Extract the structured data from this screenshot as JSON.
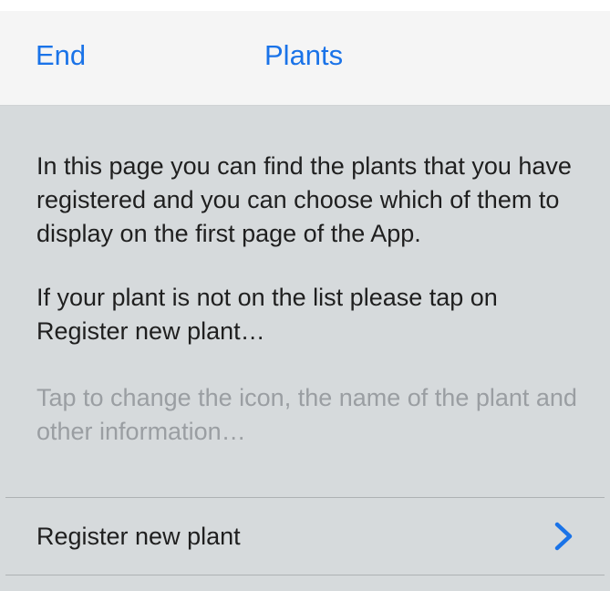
{
  "navbar": {
    "end_label": "End",
    "title": "Plants",
    "accent_color": "#1a73e8"
  },
  "content": {
    "intro": "In this page you can find the plants that you have registered and you can choose which of them to display on the first page of the App.",
    "instruction": "If your plant is not on the list please tap on Register new plant…",
    "hint": "Tap to change the icon, the name of the plant and other information…"
  },
  "list": {
    "items": [
      {
        "label": "Register new plant",
        "icon": "chevron-right-icon"
      }
    ]
  }
}
